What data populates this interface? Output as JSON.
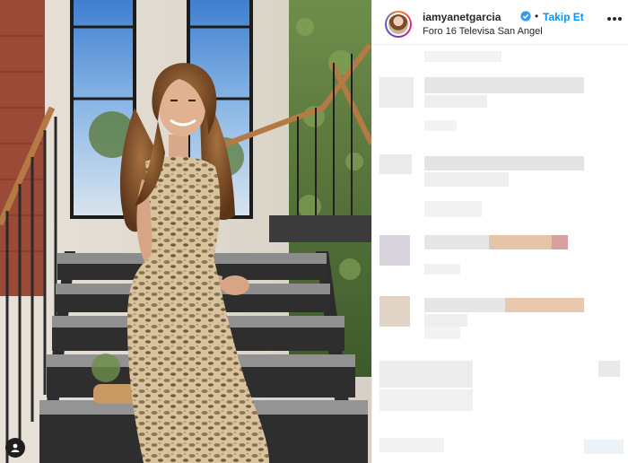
{
  "post": {
    "username": "iamyanetgarcia",
    "verified": true,
    "separator": "•",
    "follow_label": "Takip Et",
    "location": "Foro 16 Televisa San Angel"
  },
  "icons": {
    "verified": "verified-badge-icon",
    "more": "more-options-icon",
    "tagged_users": "user-tag-icon"
  },
  "colors": {
    "accent_blue": "#0095f6",
    "text_primary": "#262626",
    "pixelated_blocks": "#e6e6e6"
  }
}
